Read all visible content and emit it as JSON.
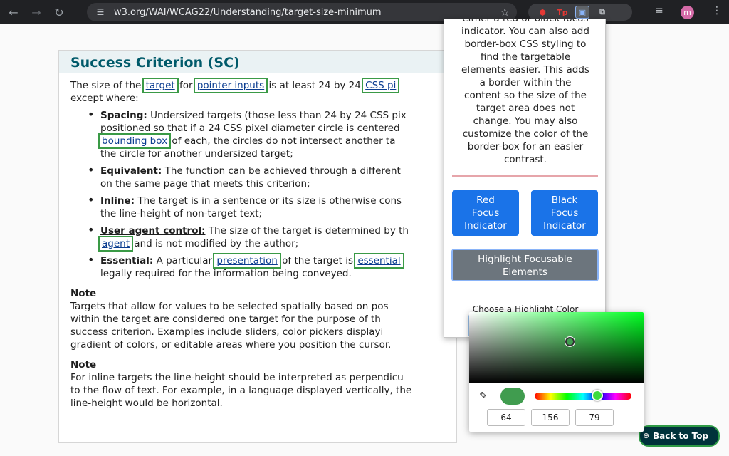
{
  "browser": {
    "url": "w3.org/WAI/WCAG22/Understanding/target-size-minimum",
    "avatar_letter": "m",
    "ext_tp_label": "Tp"
  },
  "page": {
    "heading": "Success Criterion (SC)",
    "intro_pre": "The size of the",
    "link_target": "target",
    "intro_for": "for",
    "link_pointer": "pointer inputs",
    "intro_mid": "is at least 24 by 24",
    "link_css": "CSS pi",
    "intro_except": "except where:",
    "items": [
      {
        "label": "Spacing:",
        "text1": "Undersized targets (those less than 24 by 24 CSS pix",
        "text2": "positioned so that if a 24 CSS pixel diameter circle is centered",
        "link": "bounding box",
        "text3": "of each, the circles do not intersect another ta",
        "text4": "the circle for another undersized target;"
      },
      {
        "label": "Equivalent:",
        "text1": "The function can be achieved through a different",
        "text2": "on the same page that meets this criterion;"
      },
      {
        "label": "Inline:",
        "text1": "The target is in a sentence or its size is otherwise cons",
        "text2": "the line-height of non-target text;"
      },
      {
        "label": "User agent control:",
        "text1": "The size of the target is determined by th",
        "link": "agent",
        "text2": "and is not modified by the author;"
      },
      {
        "label": "Essential:",
        "text1": "A particular",
        "link": "presentation",
        "text2": "of the target is",
        "link2": "essential",
        "text3": "legally required for the information being conveyed."
      }
    ],
    "notes": [
      {
        "title": "Note",
        "lines": [
          "Targets that allow for values to be selected spatially based on pos",
          "within the target are considered one target for the purpose of th",
          "success criterion. Examples include sliders, color pickers displayi",
          "gradient of colors, or editable areas where you position the cursor."
        ]
      },
      {
        "title": "Note",
        "lines": [
          "For inline targets the line-height should be interpreted as perpendicu",
          "to the flow of text. For example, in a language displayed vertically, the",
          "line-height would be horizontal."
        ]
      }
    ],
    "back_to_top": "Back to Top"
  },
  "popup": {
    "description_lines": [
      "either a red or black focus",
      "indicator. You can also add",
      "border-box CSS styling to",
      "find the targetable",
      "elements easier. This adds",
      "a border within the",
      "content so the size of the",
      "target area does not",
      "change. You may also",
      "customize the color of the",
      "border-box for an easier",
      "contrast."
    ],
    "red_button": [
      "Red",
      "Focus",
      "Indicator"
    ],
    "black_button": [
      "Black",
      "Focus",
      "Indicator"
    ],
    "highlight_button": [
      "Highlight Focusable",
      "Elements"
    ],
    "choose_label": "Choose a Highlight Color",
    "selected_color": "#409c4f"
  },
  "picker": {
    "r": "64",
    "g": "156",
    "b": "79"
  }
}
